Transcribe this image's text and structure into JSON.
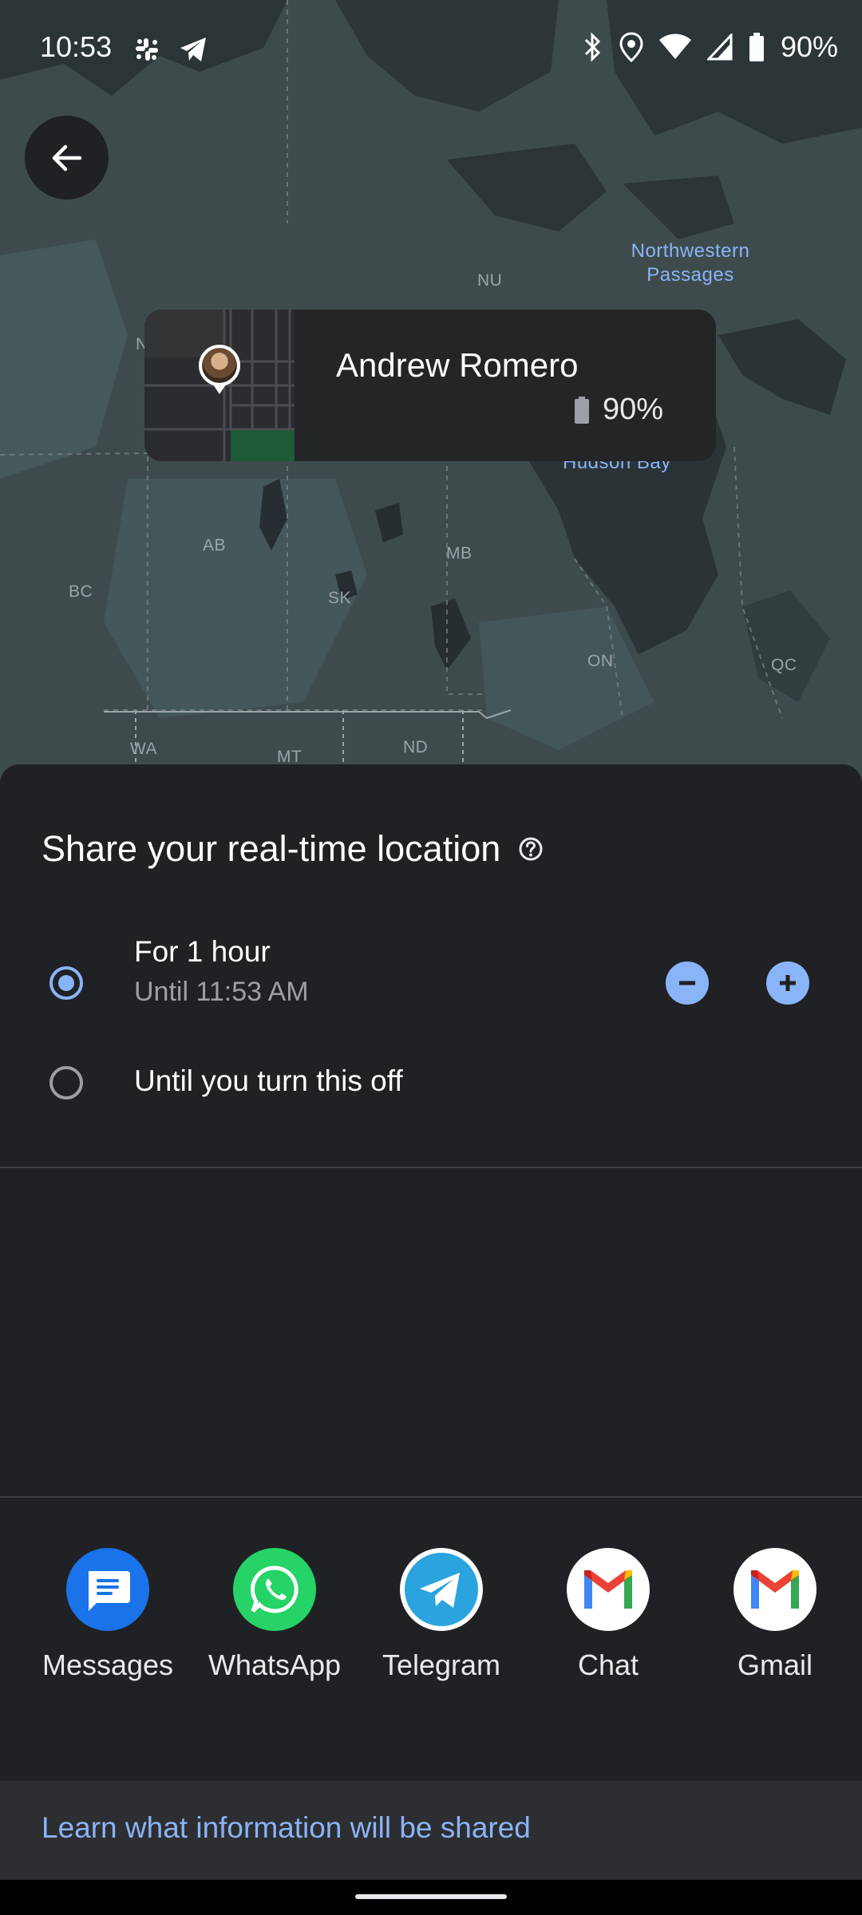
{
  "status_bar": {
    "time": "10:53",
    "battery": "90%",
    "icons_left": [
      "slack-icon",
      "telegram-icon"
    ],
    "icons_right": [
      "bluetooth-icon",
      "location-icon",
      "wifi-icon",
      "signal-icon",
      "battery-icon"
    ]
  },
  "map": {
    "labels": {
      "nu": "NU",
      "n": "N",
      "ab": "AB",
      "bc": "BC",
      "sk": "SK",
      "mb": "MB",
      "on": "ON",
      "qc": "QC",
      "wa": "WA",
      "mt": "MT",
      "nd": "ND",
      "northwestern_passages": "Northwestern Passages",
      "hudson_bay": "Hudson Bay"
    }
  },
  "person_card": {
    "name": "Andrew Romero",
    "battery": "90%"
  },
  "sheet": {
    "title": "Share your real-time location",
    "options": [
      {
        "label": "For 1 hour",
        "sublabel": "Until 11:53 AM",
        "selected": true
      },
      {
        "label": "Until you turn this off",
        "selected": false
      }
    ]
  },
  "share_targets": [
    {
      "label": "Messages",
      "icon": "messages-icon",
      "color": "#1a73e8"
    },
    {
      "label": "WhatsApp",
      "icon": "whatsapp-icon",
      "color": "#25d366"
    },
    {
      "label": "Telegram",
      "icon": "telegram-icon",
      "color": "#2aa3df"
    },
    {
      "label": "Chat",
      "icon": "gmail-icon",
      "color": "#ffffff"
    },
    {
      "label": "Gmail",
      "icon": "gmail-icon",
      "color": "#ffffff"
    }
  ],
  "footer": {
    "link": "Learn what information will be shared"
  },
  "colors": {
    "accent": "#8ab4f8",
    "sheet_bg": "#202124"
  }
}
